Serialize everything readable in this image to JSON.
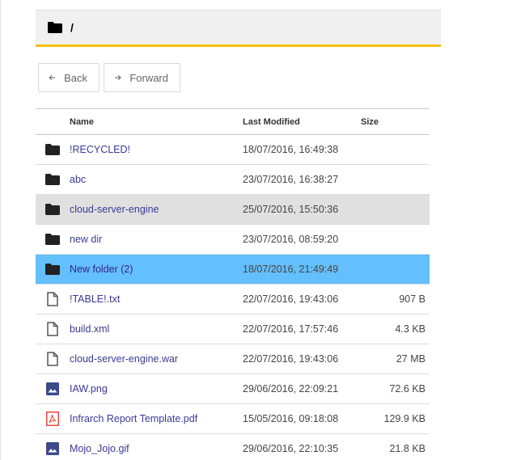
{
  "path": {
    "current": "/"
  },
  "nav": {
    "back_label": "Back",
    "forward_label": "Forward"
  },
  "columns": {
    "name": "Name",
    "modified": "Last Modified",
    "size": "Size"
  },
  "files": [
    {
      "name": "!RECYCLED!",
      "modified": "18/07/2016, 16:49:38",
      "size": "",
      "type": "folder-icon",
      "state": ""
    },
    {
      "name": "abc",
      "modified": "23/07/2016, 16:38:27",
      "size": "",
      "type": "folder-icon",
      "state": ""
    },
    {
      "name": "cloud-server-engine",
      "modified": "25/07/2016, 15:50:36",
      "size": "",
      "type": "folder-icon",
      "state": "hover"
    },
    {
      "name": "new dir",
      "modified": "23/07/2016, 08:59:20",
      "size": "",
      "type": "folder-icon",
      "state": ""
    },
    {
      "name": "New folder (2)",
      "modified": "18/07/2016, 21:49:49",
      "size": "",
      "type": "folder-icon",
      "state": "selected"
    },
    {
      "name": "!TABLE!.txt",
      "modified": "22/07/2016, 19:43:06",
      "size": "907 B",
      "type": "file-icon",
      "state": ""
    },
    {
      "name": "build.xml",
      "modified": "22/07/2016, 17:57:46",
      "size": "4.3 KB",
      "type": "file-icon",
      "state": ""
    },
    {
      "name": "cloud-server-engine.war",
      "modified": "22/07/2016, 19:43:06",
      "size": "27 MB",
      "type": "file-icon",
      "state": ""
    },
    {
      "name": "IAW.png",
      "modified": "29/06/2016, 22:09:21",
      "size": "72.6 KB",
      "type": "image-icon",
      "state": ""
    },
    {
      "name": "Infrarch Report Template.pdf",
      "modified": "15/05/2016, 09:18:08",
      "size": "129.9 KB",
      "type": "pdf-icon",
      "state": ""
    },
    {
      "name": "Mojo_Jojo.gif",
      "modified": "29/06/2016, 22:10:35",
      "size": "21.8 KB",
      "type": "image-icon",
      "state": ""
    }
  ],
  "colors": {
    "accent_underline": "#f5c000",
    "selected_row": "#64bfff",
    "hover_row": "#e0e0e0",
    "link_text": "#3a3a9a",
    "pdf_red": "#e84a3c",
    "image_blue": "#3c4a8c"
  }
}
